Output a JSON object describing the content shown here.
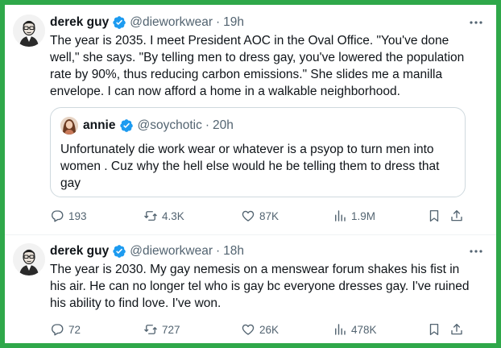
{
  "tweets": [
    {
      "name": "derek guy",
      "handle": "@dieworkwear",
      "separator": "·",
      "time": "19h",
      "text": "The year is 2035. I meet President AOC in the Oval Office. \"You've done well,\" she says. \"By telling men to dress gay, you've lowered the population rate by 90%, thus reducing carbon emissions.\" She slides me a manilla envelope. I can now afford a home in a walkable neighborhood.",
      "quote": {
        "name": "annie",
        "handle": "@soychotic",
        "separator": "·",
        "time": "20h",
        "text": "Unfortunately die work wear or whatever is a psyop to turn men into women . Cuz why the hell else would he be telling them to dress that gay"
      },
      "stats": {
        "replies": "193",
        "reposts": "4.3K",
        "likes": "87K",
        "views": "1.9M"
      }
    },
    {
      "name": "derek guy",
      "handle": "@dieworkwear",
      "separator": "·",
      "time": "18h",
      "text": "The year is 2030. My gay nemesis on a menswear forum shakes his fist in his air. He can no longer tel who is gay bc everyone dresses gay. I've ruined his ability to find love. I've won.",
      "stats": {
        "replies": "72",
        "reposts": "727",
        "likes": "26K",
        "views": "478K"
      }
    }
  ],
  "icons": {
    "verified": "verified-badge-icon",
    "more": "more-horizontal-icon",
    "reply": "reply-icon",
    "repost": "repost-icon",
    "like": "like-icon",
    "views": "views-icon",
    "bookmark": "bookmark-icon",
    "share": "share-icon"
  },
  "colors": {
    "border_frame": "#2fa84a",
    "verified": "#1d9bf0",
    "secondary_text": "#536471",
    "primary_text": "#0f1419"
  }
}
